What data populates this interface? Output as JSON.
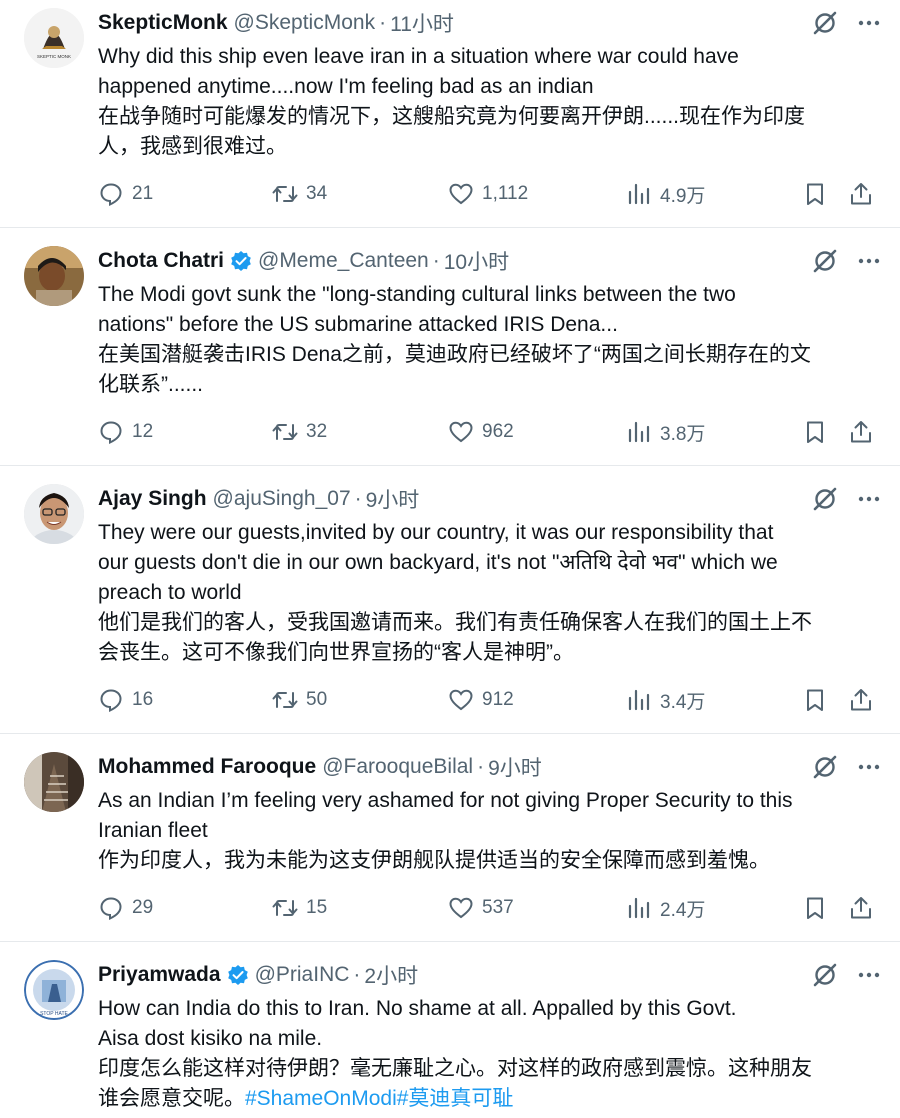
{
  "tweets": [
    {
      "name": "SkepticMonk",
      "verified": false,
      "handle": "@SkepticMonk",
      "time": "11小时",
      "lines": [
        "Why did this ship even leave iran in a situation where war could have",
        "happened anytime....now I'm feeling bad as an indian",
        "在战争随时可能爆发的情况下，这艘船究竟为何要离开伊朗......现在作为印度",
        "人，我感到很难过。"
      ],
      "replies": "21",
      "retweets": "34",
      "likes": "1,112",
      "views": "4.9万",
      "avatar_text": "SKEPTIC MONK"
    },
    {
      "name": "Chota Chatri",
      "verified": true,
      "handle": "@Meme_Canteen",
      "time": "10小时",
      "lines": [
        "The Modi govt sunk the \"long-standing cultural links between the two",
        "nations\" before the US submarine attacked IRIS Dena...",
        "在美国潜艇袭击IRIS Dena之前，莫迪政府已经破坏了“两国之间长期存在的文",
        "化联系”......"
      ],
      "replies": "12",
      "retweets": "32",
      "likes": "962",
      "views": "3.8万"
    },
    {
      "name": "Ajay Singh",
      "verified": false,
      "handle": "@ajuSingh_07",
      "time": "9小时",
      "lines": [
        "They were our guests,invited by our country, it was our responsibility that",
        "our guests don't die in our own backyard, it's not \"अतिथि देवो भव\" which we",
        "preach to world",
        "他们是我们的客人，受我国邀请而来。我们有责任确保客人在我们的国土上不",
        "会丧生。这可不像我们向世界宣扬的“客人是神明”。"
      ],
      "replies": "16",
      "retweets": "50",
      "likes": "912",
      "views": "3.4万"
    },
    {
      "name": "Mohammed Farooque",
      "verified": false,
      "handle": "@FarooqueBilal",
      "time": "9小时",
      "lines": [
        "As an Indian I’m feeling very ashamed for not giving Proper Security to this",
        "Iranian fleet",
        "作为印度人，我为未能为这支伊朗舰队提供适当的安全保障而感到羞愧。"
      ],
      "replies": "29",
      "retweets": "15",
      "likes": "537",
      "views": "2.4万"
    },
    {
      "name": "Priyamwada",
      "verified": true,
      "handle": "@PriaINC",
      "time": "2小时",
      "lines": [
        "How can India do this to Iran. No shame at all. Appalled by this Govt.",
        "Aisa dost kisiko na mile.",
        "印度怎么能这样对待伊朗？毫无廉耻之心。对这样的政府感到震惊。这种朋友",
        "谁会愿意交呢。"
      ],
      "hashtags": "#ShameOnModi#莫迪真可耻",
      "avatar_text": "STOP HATE"
    }
  ],
  "colors": {
    "text": "#0f1419",
    "secondary": "#536471",
    "verified": "#1d9bf0",
    "link": "#1d9bf0",
    "divider": "#e6e9ec"
  },
  "icons": [
    "grok-icon",
    "more-icon",
    "reply-icon",
    "retweet-icon",
    "like-icon",
    "views-icon",
    "bookmark-icon",
    "share-icon",
    "verified-icon"
  ]
}
